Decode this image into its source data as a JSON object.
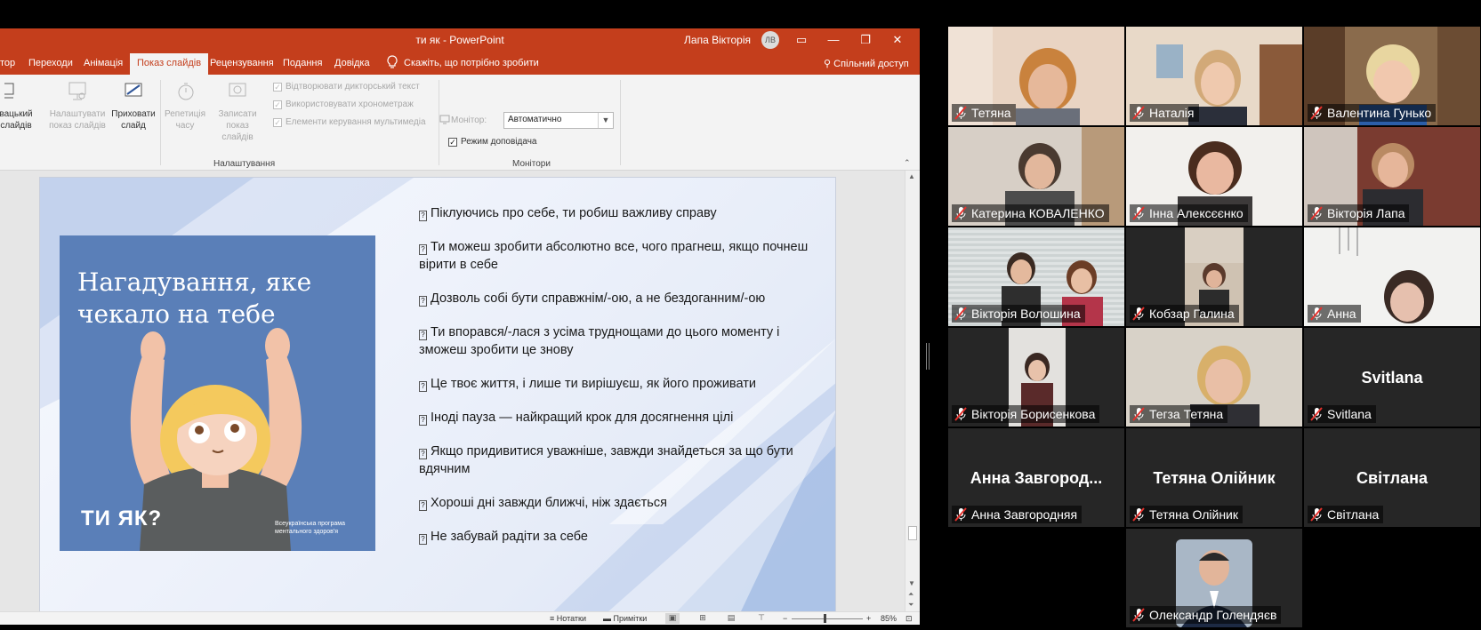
{
  "window": {
    "title": "ти як  -  PowerPoint",
    "user_name": "Лапа Вікторія",
    "user_initials": "ЛВ"
  },
  "ribbon_tabs": [
    {
      "label": "тор"
    },
    {
      "label": "Переходи"
    },
    {
      "label": "Анімація"
    },
    {
      "label": "Показ слайдів",
      "active": true
    },
    {
      "label": "Рецензування"
    },
    {
      "label": "Подання"
    },
    {
      "label": "Довідка"
    }
  ],
  "tell_me": "Скажіть, що потрібно зробити",
  "share": "Спільний доступ",
  "ribbon": {
    "custom_show": {
      "line1": "вацький",
      "line2": "слайдів"
    },
    "setup_show": {
      "line1": "Налаштувати",
      "line2": "показ слайдів"
    },
    "hide_slide": {
      "line1": "Приховати",
      "line2": "слайд"
    },
    "rehearse": {
      "line1": "Репетиція",
      "line2": "часу"
    },
    "record": {
      "line1": "Записати показ",
      "line2": "слайдів"
    },
    "check_narration": "Відтворювати дикторський текст",
    "check_timings": "Використовувати хронометраж",
    "check_media": "Елементи керування мультимедіа",
    "group_setup": "Налаштування",
    "monitor_label": "Монітор:",
    "monitor_value": "Автоматично",
    "presenter_view": "Режим доповідача",
    "group_monitors": "Монітори"
  },
  "slide": {
    "poster_title": "Нагадування, яке чекало на тебе",
    "poster_logo": "ТИ ЯК?",
    "poster_caption": "Всеукраїнська програма ментального здоров'я",
    "bullets": [
      "Піклуючись про себе, ти робиш важливу справу",
      "Ти можеш зробити абсолютно все, чого прагнеш, якщо почнеш вірити в себе",
      "Дозволь собі бути справжнім/-ою, а не бездоганним/-ою",
      "Ти впорався/-лася з усіма труднощами до цього моменту і зможеш зробити це знову",
      "Це твоє життя, і лише ти вирішуєш, як його проживати",
      "Іноді пауза — найкращий крок для досягнення цілі",
      "Якщо придивитися уважніше, завжди знайдеться за що бути вдячним",
      "Хороші дні завжди ближчі, ніж здається",
      "Не забувай радіти за себе"
    ]
  },
  "statusbar": {
    "notes": "Нотатки",
    "comments": "Примітки",
    "zoom": "85%"
  },
  "colors": {
    "ppt_accent": "#c43e1c",
    "poster_bg": "#5a7fb8",
    "active_speaker": "#24c763"
  },
  "participants": [
    {
      "name": "Тетяна",
      "video": true
    },
    {
      "name": "Наталія",
      "video": true
    },
    {
      "name": "Валентина Гунько",
      "video": true
    },
    {
      "name": "Катерина КОВАЛЕНКО",
      "video": true
    },
    {
      "name": "Інна Алексєєнко",
      "video": true
    },
    {
      "name": "Вікторія Лапа",
      "video": true,
      "active": true
    },
    {
      "name": "Вікторія Волошина",
      "video": true
    },
    {
      "name": "Кобзар Галина",
      "video": true
    },
    {
      "name": "Анна",
      "video": true
    },
    {
      "name": "Вікторія Борисенкова",
      "video": true
    },
    {
      "name": "Тегза Тетяна",
      "video": true
    },
    {
      "name": "Svitlana",
      "video": false,
      "display": "Svitlana"
    },
    {
      "name": "Анна Завгородняя",
      "video": false,
      "display": "Анна Завгород..."
    },
    {
      "name": "Тетяна Олійник",
      "video": false,
      "display": "Тетяна Олійник"
    },
    {
      "name": "Світлана",
      "video": false,
      "display": "Світлана"
    },
    {
      "name": "Олександр Голендяєв",
      "video": true
    }
  ]
}
